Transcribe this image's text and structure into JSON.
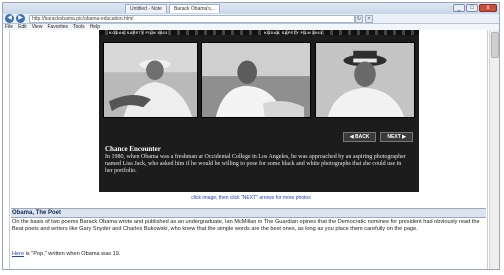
{
  "browser": {
    "tabs": [
      "Untitled - Note",
      "Barack Obama's..."
    ],
    "address": "http://barackobama.pic/obama-education.html",
    "menu": [
      "File",
      "Edit",
      "View",
      "Favorites",
      "Tools",
      "Help"
    ],
    "window_controls": {
      "minimize": "_",
      "maximize": "□",
      "close": "x"
    },
    "nav_back": "◀",
    "nav_forward": "▶"
  },
  "gallery": {
    "film_labels": [
      "KODAK SAFETY FILM 5063",
      "KODAK SAFETY FILM 5063"
    ],
    "back_label": "◀ BACK",
    "next_label": "NEXT ▶",
    "caption_title": "Chance Encounter",
    "caption_text": "In 1980, when Obama was a freshman at Occidental College in Los Angeles, he was approached by an aspiring photographer named Lisa Jack, who asked him if he would be willing to pose for some black and white photographs that she could use in her portfolio.",
    "hint": "click image, then click \"NEXT\" arrows for more photos"
  },
  "article": {
    "title": "Obama, The Poet",
    "body": "On the basis of two poems Barack Obama wrote and published as an undergraduate, Ian McMillan in The Guardian opines that the Democratic nominee for president had obviously read the Beat poets and writers like Gary Snyder and Charles Bukowski, who knew that the simple words are the best ones, as long as you place them carefully on the page.",
    "footnote_link": "Here",
    "footnote_text": " is \"Pop,\" written when Obama was 19."
  }
}
